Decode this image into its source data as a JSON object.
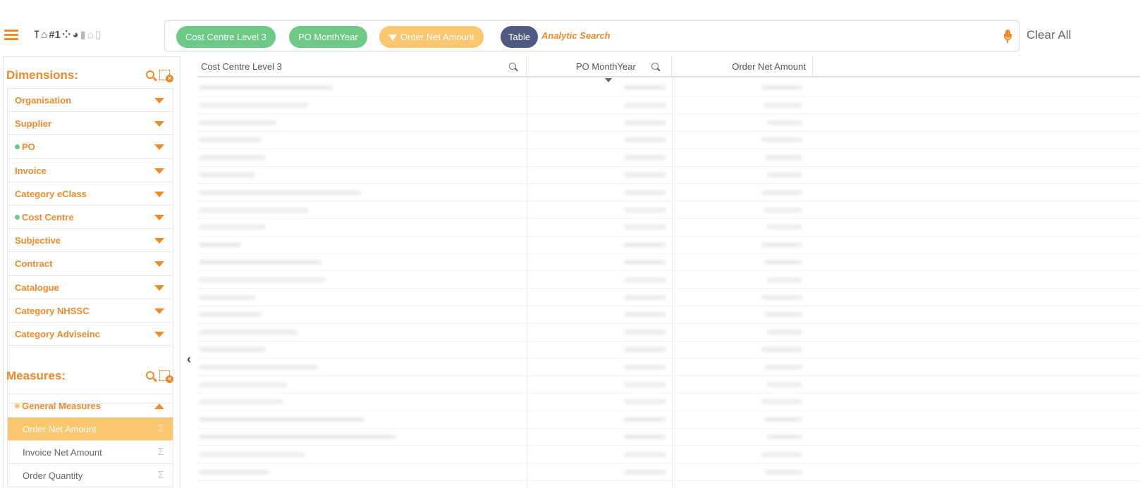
{
  "toolbar": {
    "chart_icons": [
      "table-type-icon",
      "kpi-icon",
      "number-icon",
      "scatter-icon",
      "pie-icon",
      "bar-icon",
      "combo-icon",
      "mixed-chart-icon"
    ],
    "chips": [
      {
        "label": "Cost Centre Level 3",
        "kind": "dimension",
        "color": "#6cc986"
      },
      {
        "label": "PO MonthYear",
        "kind": "dimension",
        "color": "#6cc986"
      },
      {
        "label": "Order Net Amount",
        "kind": "measure",
        "color": "#fcc66e"
      },
      {
        "label": "Table",
        "kind": "chart-type",
        "color": "#4f5a83"
      }
    ],
    "search_placeholder": "Analytic Search",
    "clear_all": "Clear All"
  },
  "sidebar": {
    "dimensions_title": "Dimensions:",
    "dimensions": [
      {
        "label": "Organisation",
        "selected": false
      },
      {
        "label": "Supplier",
        "selected": false
      },
      {
        "label": "PO",
        "selected": true
      },
      {
        "label": "Invoice",
        "selected": false
      },
      {
        "label": "Category eClass",
        "selected": false
      },
      {
        "label": "Cost Centre",
        "selected": true
      },
      {
        "label": "Subjective",
        "selected": false
      },
      {
        "label": "Contract",
        "selected": false
      },
      {
        "label": "Catalogue",
        "selected": false
      },
      {
        "label": "Category NHSSC",
        "selected": false
      },
      {
        "label": "Category Adviseinc",
        "selected": false
      }
    ],
    "measures_title": "Measures:",
    "measure_group": "General Measures",
    "measures": [
      {
        "label": "Order Net Amount",
        "active": true
      },
      {
        "label": "Invoice Net Amount",
        "active": false
      },
      {
        "label": "Order Quantity",
        "active": false
      }
    ],
    "sigma": "Σ",
    "collapse_glyph": "‹"
  },
  "table": {
    "columns": [
      {
        "label": "Cost Centre Level 3",
        "align": "left",
        "searchable": true
      },
      {
        "label": "PO MonthYear",
        "align": "right",
        "searchable": true,
        "sorted": "desc"
      },
      {
        "label": "Order Net Amount",
        "align": "right",
        "searchable": false
      }
    ],
    "row_count": 23,
    "rows_blurred": true
  },
  "colors": {
    "accent": "#ee8a2c",
    "dimension_chip": "#6cc986",
    "measure_chip": "#fcc66e",
    "chart_chip": "#4f5a83"
  }
}
